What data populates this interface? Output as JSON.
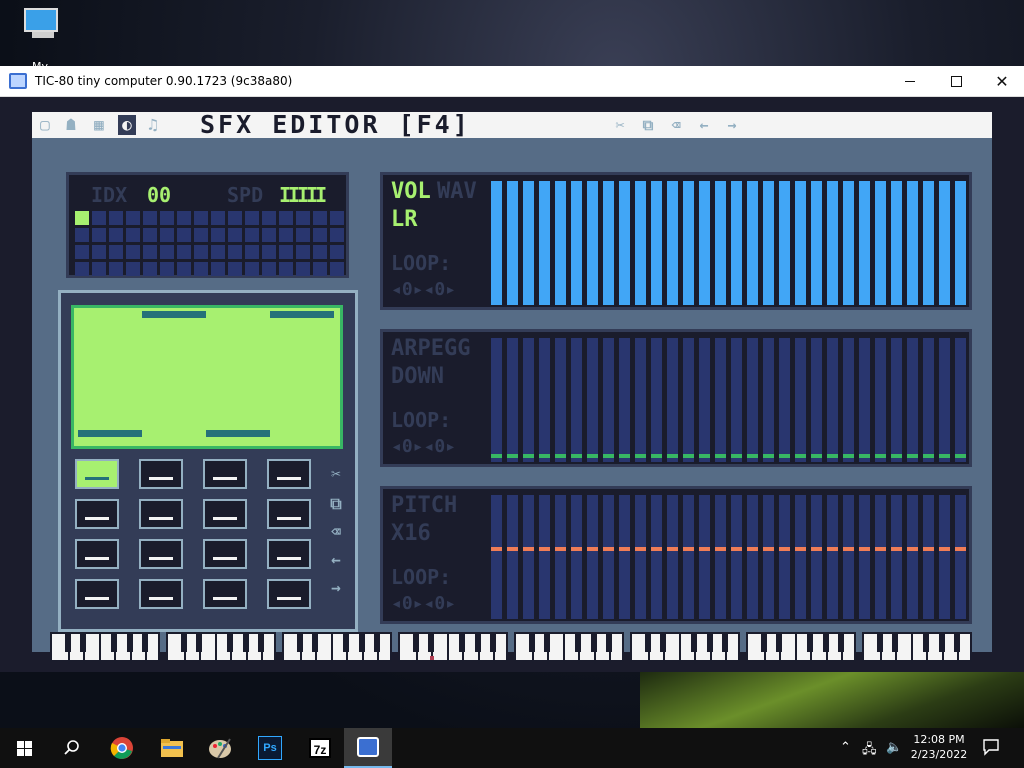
{
  "desktop": {
    "icon_label": "My Computer"
  },
  "window": {
    "title": "TIC-80 tiny computer 0.90.1723 (9c38a80)",
    "minimize": "—",
    "maximize": "☐",
    "close": "✕"
  },
  "tic": {
    "menu_icons": [
      "▢",
      "☗",
      "▦",
      "◐",
      "♫"
    ],
    "title": "SFX EDITOR [F4]",
    "tool_icons": [
      "✂",
      "⧉",
      "⌫",
      "←",
      "→"
    ],
    "idx_label": "IDX",
    "idx_value": "00",
    "spd_label": "SPD",
    "spd_value": "IIIII",
    "vol": {
      "label1": "VOL",
      "label2": "WAV",
      "label3": "LR",
      "loop": "LOOP:",
      "loop_values": "◂0▸◂0▸"
    },
    "arp": {
      "label1": "ARPEGG",
      "label2": "DOWN",
      "loop": "LOOP:",
      "loop_values": "◂0▸◂0▸"
    },
    "pitch": {
      "label1": "PITCH",
      "label2": "X16",
      "loop": "LOOP:",
      "loop_values": "◂0▸◂0▸"
    },
    "side_icons": [
      "✂",
      "⧉",
      "⌫",
      "←",
      "→"
    ]
  },
  "colors": {
    "green": "#a7f070",
    "blue": "#41a6f6",
    "arp_line": "#38b764",
    "pitch_line": "#ef7d57"
  },
  "taskbar": {
    "time": "12:08 PM",
    "date": "2/23/2022",
    "apps": [
      "start",
      "search",
      "chrome",
      "file-explorer",
      "paint",
      "photoshop",
      "7zip",
      "tic80"
    ]
  }
}
